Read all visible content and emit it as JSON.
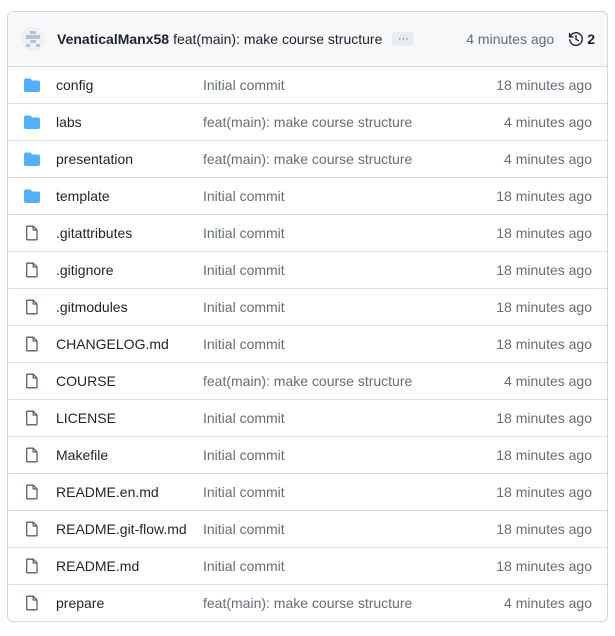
{
  "header": {
    "author": "VenaticalManx58",
    "commit_message": "feat(main): make course structure",
    "ellipsis": "···",
    "time": "4 minutes ago",
    "history_count": "2"
  },
  "files": [
    {
      "name": "config",
      "type": "folder",
      "message": "Initial commit",
      "time": "18 minutes ago"
    },
    {
      "name": "labs",
      "type": "folder",
      "message": "feat(main): make course structure",
      "time": "4 minutes ago"
    },
    {
      "name": "presentation",
      "type": "folder",
      "message": "feat(main): make course structure",
      "time": "4 minutes ago"
    },
    {
      "name": "template",
      "type": "folder",
      "message": "Initial commit",
      "time": "18 minutes ago"
    },
    {
      "name": ".gitattributes",
      "type": "file",
      "message": "Initial commit",
      "time": "18 minutes ago"
    },
    {
      "name": ".gitignore",
      "type": "file",
      "message": "Initial commit",
      "time": "18 minutes ago"
    },
    {
      "name": ".gitmodules",
      "type": "file",
      "message": "Initial commit",
      "time": "18 minutes ago"
    },
    {
      "name": "CHANGELOG.md",
      "type": "file",
      "message": "Initial commit",
      "time": "18 minutes ago"
    },
    {
      "name": "COURSE",
      "type": "file",
      "message": "feat(main): make course structure",
      "time": "4 minutes ago"
    },
    {
      "name": "LICENSE",
      "type": "file",
      "message": "Initial commit",
      "time": "18 minutes ago"
    },
    {
      "name": "Makefile",
      "type": "file",
      "message": "Initial commit",
      "time": "18 minutes ago"
    },
    {
      "name": "README.en.md",
      "type": "file",
      "message": "Initial commit",
      "time": "18 minutes ago"
    },
    {
      "name": "README.git-flow.md",
      "type": "file",
      "message": "Initial commit",
      "time": "18 minutes ago"
    },
    {
      "name": "README.md",
      "type": "file",
      "message": "Initial commit",
      "time": "18 minutes ago"
    },
    {
      "name": "prepare",
      "type": "file",
      "message": "feat(main): make course structure",
      "time": "4 minutes ago"
    }
  ],
  "colors": {
    "folder": "#54aeff",
    "file_icon": "#57606a",
    "muted_text": "#656d76",
    "border": "#d0d7de"
  }
}
